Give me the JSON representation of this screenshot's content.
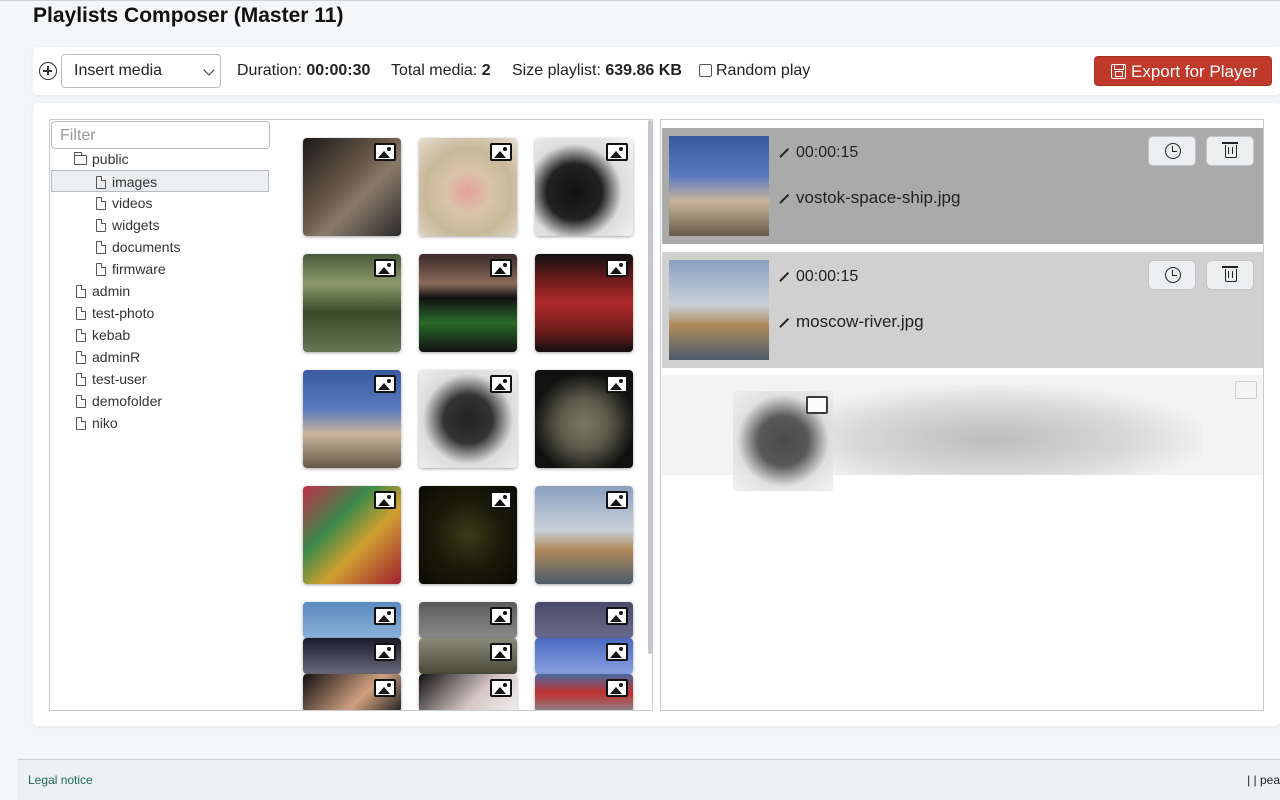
{
  "page": {
    "title": "Playlists Composer (Master 11)"
  },
  "toolbar": {
    "insert_select": "Insert media",
    "duration_label": "Duration:",
    "duration_value": "00:00:30",
    "total_label": "Total media:",
    "total_value": "2",
    "size_label": "Size playlist:",
    "size_value": "639.86 KB",
    "random_label": "Random play",
    "export_label": "Export for Player"
  },
  "filter": {
    "placeholder": "Filter"
  },
  "tree": {
    "public": "public",
    "images": "images",
    "videos": "videos",
    "widgets": "widgets",
    "documents": "documents",
    "firmware": "firmware",
    "admin": "admin",
    "test_photo": "test-photo",
    "kebab": "kebab",
    "adminR": "adminR",
    "test_user": "test-user",
    "demofolder": "demofolder",
    "niko": "niko"
  },
  "playlist": [
    {
      "duration": "00:00:15",
      "name": "vostok-space-ship.jpg"
    },
    {
      "duration": "00:00:15",
      "name": "moscow-river.jpg"
    }
  ],
  "footer": {
    "legal": "Legal notice",
    "right": "| | pea"
  },
  "colors": {
    "export_button": "#c0392b",
    "active_item": "#aaaaaa",
    "inactive_item": "#d0d0d0",
    "legal_link": "#1e6b56"
  }
}
